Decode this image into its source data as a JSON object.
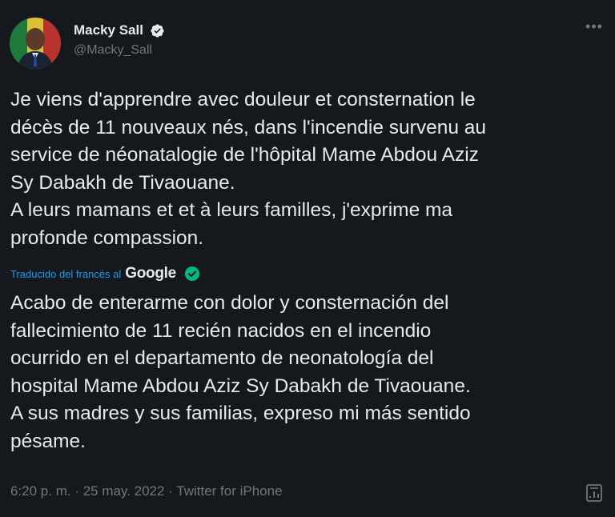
{
  "author": {
    "name": "Macky Sall",
    "handle": "@Macky_Sall"
  },
  "tweet": {
    "original_text": "Je viens d'apprendre avec douleur et consternation le\ndécès de 11 nouveaux nés, dans l'incendie survenu au\nservice de néonatalogie de l'hôpital Mame Abdou Aziz\nSy Dabakh de Tivaouane.\nA leurs mamans et et à leurs familles, j'exprime ma\nprofonde compassion.",
    "translation_label": "Traducido del francés al",
    "translation_provider": "Google",
    "translated_text": "Acabo de enterarme con dolor y consternación del\nfallecimiento de 11 recién nacidos en el incendio\nocurrido en el departamento de neonatología del\nhospital Mame Abdou Aziz Sy Dabakh de Tivaouane.\n A sus madres y sus familias, expreso mi más sentido\npésame.",
    "meta": "6:20 p. m. · 25 may. 2022 · Twitter for iPhone"
  },
  "icons": {
    "more": "more-icon",
    "verified": "verified-badge-icon",
    "google_check": "google-verified-icon",
    "analytics": "analytics-icon"
  },
  "colors": {
    "background": "#15181c",
    "text": "#e7e9ea",
    "muted": "#71767b",
    "link": "#1d9bf0",
    "verified": "#e7e9ea",
    "google_check": "#00ba7c"
  }
}
